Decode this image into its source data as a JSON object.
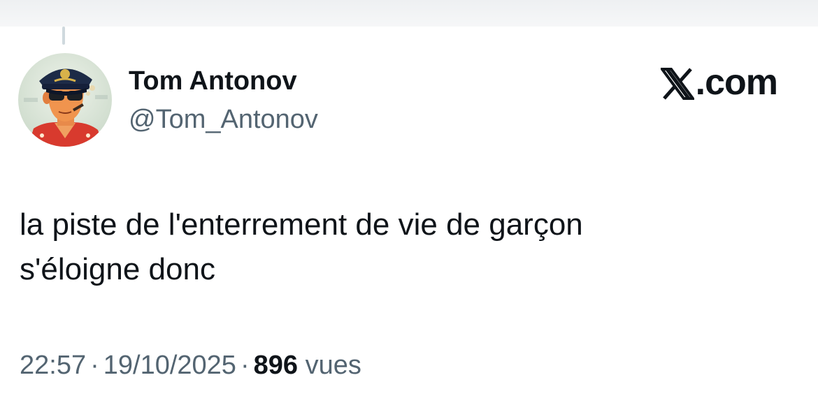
{
  "author": {
    "display_name": "Tom Antonov",
    "handle": "@Tom_Antonov"
  },
  "brand": {
    "label": ".com",
    "icon": "x-logo-icon"
  },
  "tweet": {
    "text_lines": [
      "la piste de l'enterrement de vie de garçon",
      "s'éloigne donc"
    ]
  },
  "meta": {
    "time": "22:57",
    "separator": "·",
    "date": "19/10/2025",
    "views_count": "896",
    "views_label": "vues"
  },
  "colors": {
    "primary_text": "#0f1419",
    "secondary_text": "#536471",
    "thread_line": "#cfd9de"
  }
}
